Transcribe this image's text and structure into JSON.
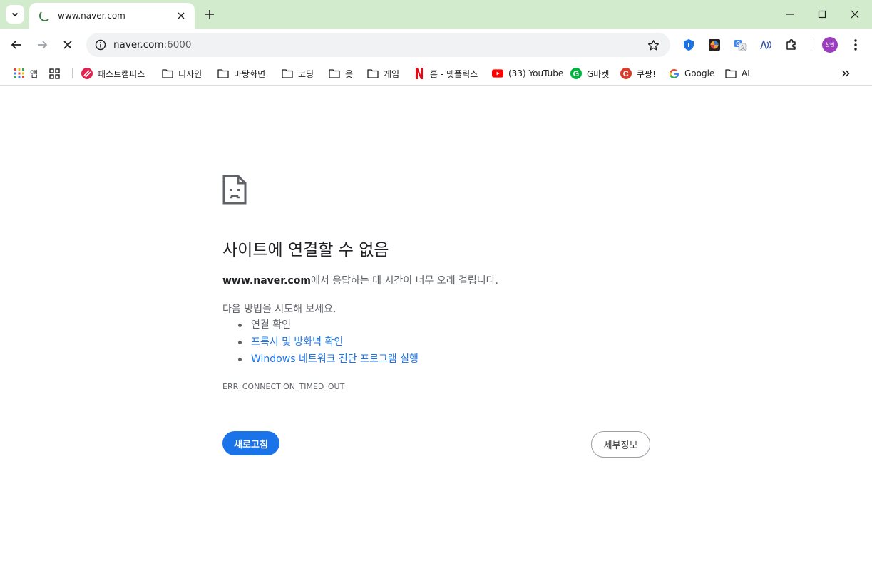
{
  "colors": {
    "titlebar": "#d3ebcd",
    "omnibox": "#f0f2f3",
    "link": "#1a73e8",
    "primary_button": "#1a73e8",
    "avatar": "#9b3fbf"
  },
  "tab": {
    "title": "www.naver.com",
    "icon": "loading-spinner-icon",
    "close_icon": "close-icon"
  },
  "window": {
    "controls": [
      "minimize-icon",
      "maximize-icon",
      "close-icon"
    ]
  },
  "toolbar": {
    "back_icon": "back-arrow-icon",
    "forward_icon": "forward-arrow-icon",
    "stop_icon": "stop-icon",
    "omnibox": {
      "host": "naver.com",
      "port": ":6000",
      "info_icon": "info-icon",
      "star_icon": "star-icon"
    },
    "extensions": [
      "shield-icon",
      "extension-colorful-icon",
      "translate-icon",
      "ai-extension-icon",
      "puzzle-icon"
    ],
    "avatar_label": "찬빈",
    "menu_icon": "kebab-menu-icon"
  },
  "bookmarks": {
    "items": [
      {
        "label": "앱",
        "icon": "apps-grid-icon"
      },
      {
        "label": "",
        "icon": "tab-groups-icon"
      },
      {
        "label": "패스트캠퍼스",
        "icon": "fastcampus-icon"
      },
      {
        "label": "디자인",
        "icon": "folder-icon"
      },
      {
        "label": "바탕화면",
        "icon": "folder-icon"
      },
      {
        "label": "코딩",
        "icon": "folder-icon"
      },
      {
        "label": "옷",
        "icon": "folder-icon"
      },
      {
        "label": "게임",
        "icon": "folder-icon"
      },
      {
        "label": "홈 - 넷플릭스",
        "icon": "netflix-icon"
      },
      {
        "label": "(33) YouTube",
        "icon": "youtube-icon"
      },
      {
        "label": "G마켓",
        "icon": "gmarket-icon"
      },
      {
        "label": "쿠팡!",
        "icon": "coupang-icon"
      },
      {
        "label": "Google",
        "icon": "google-icon"
      },
      {
        "label": "AI",
        "icon": "folder-icon"
      }
    ],
    "overflow_icon": "chevron-double-right-icon"
  },
  "error": {
    "icon": "sad-page-icon",
    "title": "사이트에 연결할 수 없음",
    "host": "www.naver.com",
    "description_suffix": "에서 응답하는 데 시간이 너무 오래 걸립니다.",
    "try_label": "다음 방법을 시도해 보세요.",
    "suggestions": [
      "연결 확인",
      "프록시 및 방화벽 확인",
      "Windows 네트워크 진단 프로그램 실행"
    ],
    "code": "ERR_CONNECTION_TIMED_OUT",
    "reload_label": "새로고침",
    "details_label": "세부정보"
  }
}
